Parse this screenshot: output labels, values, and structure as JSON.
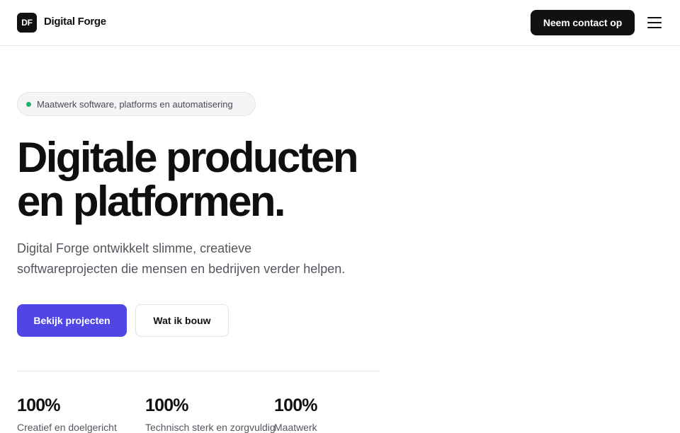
{
  "header": {
    "logo_mark": "DF",
    "logo_text": "Digital Forge",
    "contact_label": "Neem contact op",
    "menu_icon": "hamburger-menu-icon"
  },
  "hero": {
    "badge_text": "Maatwerk software, platforms en automatisering",
    "badge_dot_color": "#21b36b",
    "title_lines": [
      "Digitale producten",
      "en platformen."
    ],
    "subtitle_lines": [
      "Digital Forge ontwikkelt slimme, creatieve",
      "softwareprojecten die mensen en bedrijven verder helpen."
    ],
    "primary_button": "Bekijk projecten",
    "secondary_button": "Wat ik bouw"
  },
  "stats": [
    {
      "value": "100%",
      "label": "Creatief en doelgericht"
    },
    {
      "value": "100%",
      "label": "Technisch sterk en zorgvuldig"
    },
    {
      "value": "100%",
      "label": "Maatwerk"
    }
  ],
  "colors": {
    "accent": "#4f46e5",
    "dark": "#111114",
    "text_muted": "#55555e"
  }
}
